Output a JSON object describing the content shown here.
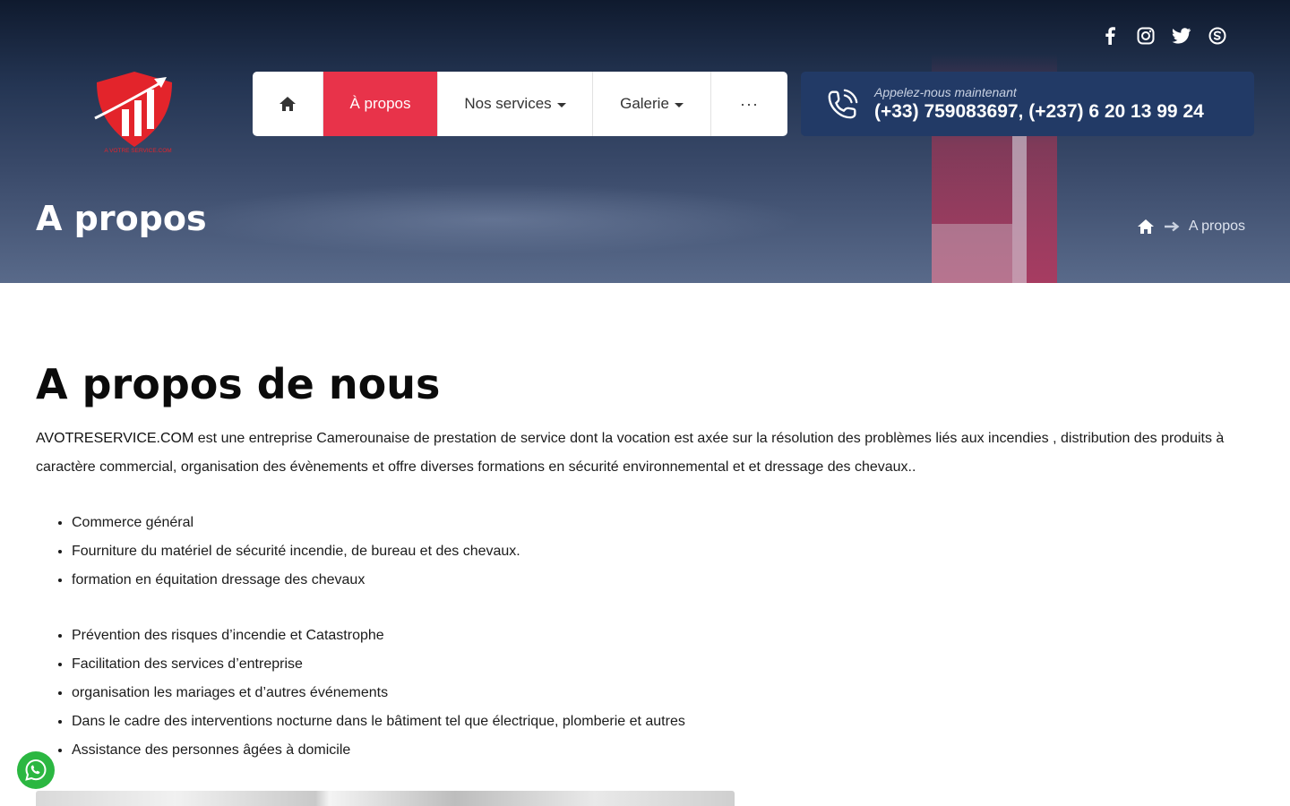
{
  "colors": {
    "accent": "#e8334a",
    "call_box": "#223a66",
    "whatsapp": "#2bb741"
  },
  "social_icons": [
    "facebook-icon",
    "instagram-icon",
    "twitter-icon",
    "skype-icon"
  ],
  "logo": {
    "text": "A VOTRE SERVICE.COM"
  },
  "nav": {
    "home_icon": "home-icon",
    "about": "À propos",
    "services": "Nos services",
    "gallery": "Galerie",
    "more": "···"
  },
  "call": {
    "label": "Appelez-nous maintenant",
    "numbers": "(+33) 759083697, (+237) 6 20 13 99 24"
  },
  "hero": {
    "title": "A propos",
    "breadcrumb_current": "A propos"
  },
  "content": {
    "heading": "A propos de nous",
    "brand": "AVOTRESERVICE.COM",
    "intro": " est une entreprise Camerounaise de prestation de service dont la vocation est axée sur la résolution des problèmes liés aux incendies , distribution des produits à caractère commercial, organisation des évènements et offre diverses formations en sécurité environnemental et et dressage des chevaux..",
    "list1": [
      "Commerce général",
      "Fourniture du matériel de sécurité incendie, de bureau et des chevaux.",
      "formation en équitation dressage des chevaux"
    ],
    "list2": [
      "Prévention des risques d’incendie et Catastrophe",
      "Facilitation des services d’entreprise",
      "organisation les mariages et d’autres événements",
      "Dans le cadre des interventions nocturne dans le bâtiment tel que électrique, plomberie et autres",
      "Assistance des personnes âgées à domicile"
    ]
  }
}
